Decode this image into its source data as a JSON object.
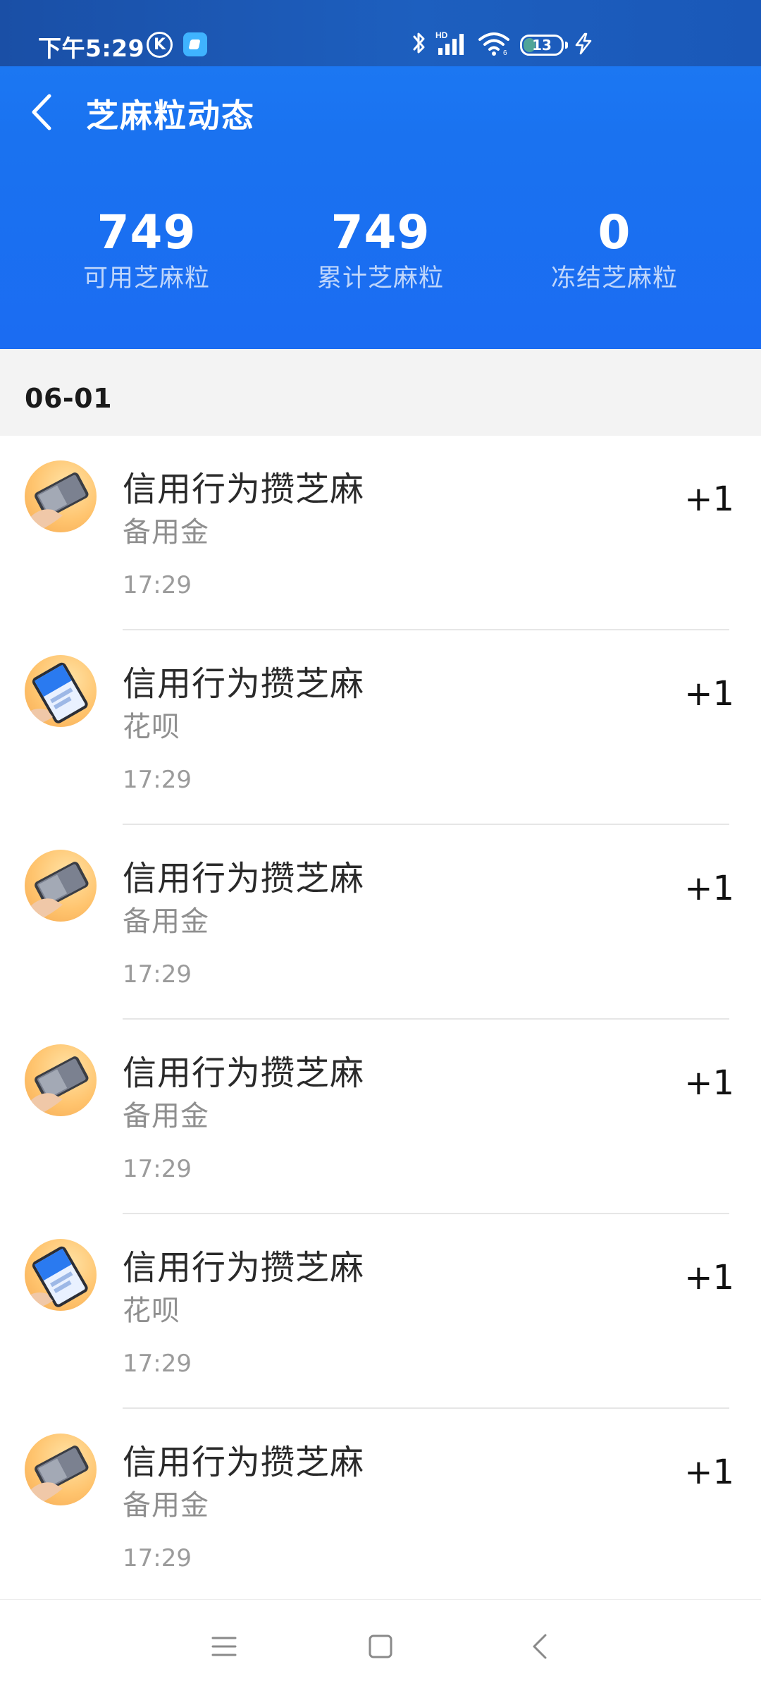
{
  "status_bar": {
    "time": "下午5:29",
    "k_badge": "K",
    "app_icon": "app-icon",
    "battery": "13",
    "icons": [
      "bluetooth-icon",
      "hd-signal-icon",
      "wifi-icon",
      "battery-icon",
      "charging-icon"
    ]
  },
  "header": {
    "title": "芝麻粒动态",
    "back_icon": "back-arrow-icon"
  },
  "stats": [
    {
      "value": "749",
      "label": "可用芝麻粒"
    },
    {
      "value": "749",
      "label": "累计芝麻粒"
    },
    {
      "value": "0",
      "label": "冻结芝麻粒"
    }
  ],
  "date_group": "06-01",
  "items": [
    {
      "title": "信用行为攒芝麻",
      "sub": "备用金",
      "time": "17:29",
      "amount": "+1",
      "avatar": "phone-hand-icon"
    },
    {
      "title": "信用行为攒芝麻",
      "sub": "花呗",
      "time": "17:29",
      "amount": "+1",
      "avatar": "phone-screen-icon"
    },
    {
      "title": "信用行为攒芝麻",
      "sub": "备用金",
      "time": "17:29",
      "amount": "+1",
      "avatar": "phone-hand-icon"
    },
    {
      "title": "信用行为攒芝麻",
      "sub": "备用金",
      "time": "17:29",
      "amount": "+1",
      "avatar": "phone-hand-icon"
    },
    {
      "title": "信用行为攒芝麻",
      "sub": "花呗",
      "time": "17:29",
      "amount": "+1",
      "avatar": "phone-screen-icon"
    },
    {
      "title": "信用行为攒芝麻",
      "sub": "备用金",
      "time": "17:29",
      "amount": "+1",
      "avatar": "phone-hand-icon"
    }
  ],
  "system_nav": [
    "menu-icon",
    "home-icon",
    "back-icon"
  ],
  "colors": {
    "header_blue": "#1b74f2",
    "status_bar_blue": "#1d5fbf",
    "date_bg": "#f3f3f3",
    "avatar_orange": "#ffc46e"
  }
}
